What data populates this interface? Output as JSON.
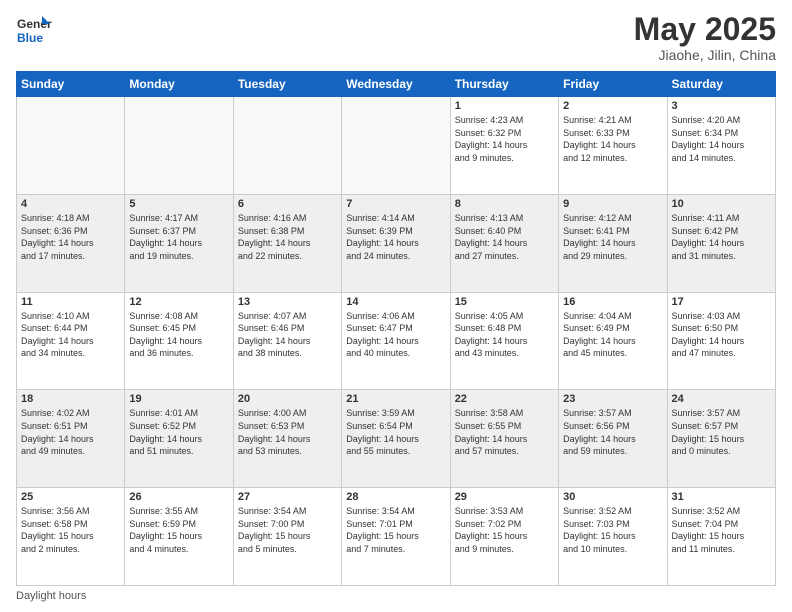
{
  "header": {
    "logo_general": "General",
    "logo_blue": "Blue",
    "month_title": "May 2025",
    "location": "Jiaohe, Jilin, China"
  },
  "days_of_week": [
    "Sunday",
    "Monday",
    "Tuesday",
    "Wednesday",
    "Thursday",
    "Friday",
    "Saturday"
  ],
  "weeks": [
    [
      {
        "day": "",
        "info": ""
      },
      {
        "day": "",
        "info": ""
      },
      {
        "day": "",
        "info": ""
      },
      {
        "day": "",
        "info": ""
      },
      {
        "day": "1",
        "info": "Sunrise: 4:23 AM\nSunset: 6:32 PM\nDaylight: 14 hours\nand 9 minutes."
      },
      {
        "day": "2",
        "info": "Sunrise: 4:21 AM\nSunset: 6:33 PM\nDaylight: 14 hours\nand 12 minutes."
      },
      {
        "day": "3",
        "info": "Sunrise: 4:20 AM\nSunset: 6:34 PM\nDaylight: 14 hours\nand 14 minutes."
      }
    ],
    [
      {
        "day": "4",
        "info": "Sunrise: 4:18 AM\nSunset: 6:36 PM\nDaylight: 14 hours\nand 17 minutes."
      },
      {
        "day": "5",
        "info": "Sunrise: 4:17 AM\nSunset: 6:37 PM\nDaylight: 14 hours\nand 19 minutes."
      },
      {
        "day": "6",
        "info": "Sunrise: 4:16 AM\nSunset: 6:38 PM\nDaylight: 14 hours\nand 22 minutes."
      },
      {
        "day": "7",
        "info": "Sunrise: 4:14 AM\nSunset: 6:39 PM\nDaylight: 14 hours\nand 24 minutes."
      },
      {
        "day": "8",
        "info": "Sunrise: 4:13 AM\nSunset: 6:40 PM\nDaylight: 14 hours\nand 27 minutes."
      },
      {
        "day": "9",
        "info": "Sunrise: 4:12 AM\nSunset: 6:41 PM\nDaylight: 14 hours\nand 29 minutes."
      },
      {
        "day": "10",
        "info": "Sunrise: 4:11 AM\nSunset: 6:42 PM\nDaylight: 14 hours\nand 31 minutes."
      }
    ],
    [
      {
        "day": "11",
        "info": "Sunrise: 4:10 AM\nSunset: 6:44 PM\nDaylight: 14 hours\nand 34 minutes."
      },
      {
        "day": "12",
        "info": "Sunrise: 4:08 AM\nSunset: 6:45 PM\nDaylight: 14 hours\nand 36 minutes."
      },
      {
        "day": "13",
        "info": "Sunrise: 4:07 AM\nSunset: 6:46 PM\nDaylight: 14 hours\nand 38 minutes."
      },
      {
        "day": "14",
        "info": "Sunrise: 4:06 AM\nSunset: 6:47 PM\nDaylight: 14 hours\nand 40 minutes."
      },
      {
        "day": "15",
        "info": "Sunrise: 4:05 AM\nSunset: 6:48 PM\nDaylight: 14 hours\nand 43 minutes."
      },
      {
        "day": "16",
        "info": "Sunrise: 4:04 AM\nSunset: 6:49 PM\nDaylight: 14 hours\nand 45 minutes."
      },
      {
        "day": "17",
        "info": "Sunrise: 4:03 AM\nSunset: 6:50 PM\nDaylight: 14 hours\nand 47 minutes."
      }
    ],
    [
      {
        "day": "18",
        "info": "Sunrise: 4:02 AM\nSunset: 6:51 PM\nDaylight: 14 hours\nand 49 minutes."
      },
      {
        "day": "19",
        "info": "Sunrise: 4:01 AM\nSunset: 6:52 PM\nDaylight: 14 hours\nand 51 minutes."
      },
      {
        "day": "20",
        "info": "Sunrise: 4:00 AM\nSunset: 6:53 PM\nDaylight: 14 hours\nand 53 minutes."
      },
      {
        "day": "21",
        "info": "Sunrise: 3:59 AM\nSunset: 6:54 PM\nDaylight: 14 hours\nand 55 minutes."
      },
      {
        "day": "22",
        "info": "Sunrise: 3:58 AM\nSunset: 6:55 PM\nDaylight: 14 hours\nand 57 minutes."
      },
      {
        "day": "23",
        "info": "Sunrise: 3:57 AM\nSunset: 6:56 PM\nDaylight: 14 hours\nand 59 minutes."
      },
      {
        "day": "24",
        "info": "Sunrise: 3:57 AM\nSunset: 6:57 PM\nDaylight: 15 hours\nand 0 minutes."
      }
    ],
    [
      {
        "day": "25",
        "info": "Sunrise: 3:56 AM\nSunset: 6:58 PM\nDaylight: 15 hours\nand 2 minutes."
      },
      {
        "day": "26",
        "info": "Sunrise: 3:55 AM\nSunset: 6:59 PM\nDaylight: 15 hours\nand 4 minutes."
      },
      {
        "day": "27",
        "info": "Sunrise: 3:54 AM\nSunset: 7:00 PM\nDaylight: 15 hours\nand 5 minutes."
      },
      {
        "day": "28",
        "info": "Sunrise: 3:54 AM\nSunset: 7:01 PM\nDaylight: 15 hours\nand 7 minutes."
      },
      {
        "day": "29",
        "info": "Sunrise: 3:53 AM\nSunset: 7:02 PM\nDaylight: 15 hours\nand 9 minutes."
      },
      {
        "day": "30",
        "info": "Sunrise: 3:52 AM\nSunset: 7:03 PM\nDaylight: 15 hours\nand 10 minutes."
      },
      {
        "day": "31",
        "info": "Sunrise: 3:52 AM\nSunset: 7:04 PM\nDaylight: 15 hours\nand 11 minutes."
      }
    ]
  ],
  "footer": {
    "note": "Daylight hours"
  },
  "colors": {
    "header_bg": "#1565c0",
    "accent": "#1565c0"
  }
}
